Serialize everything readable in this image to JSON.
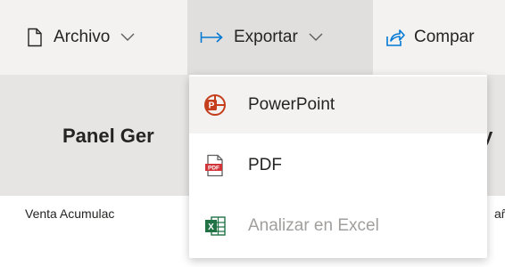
{
  "toolbar": {
    "archivo_label": "Archivo",
    "exportar_label": "Exportar",
    "compartir_label": "Compar"
  },
  "report": {
    "panel_title": "Panel Ger",
    "panel_title_tail": "y",
    "venta_label": "Venta Acumulac",
    "venta_tail": "añ"
  },
  "export_menu": {
    "items": [
      {
        "label": "PowerPoint",
        "icon": "powerpoint-icon",
        "enabled": true,
        "hovered": true
      },
      {
        "label": "PDF",
        "icon": "pdf-icon",
        "enabled": true
      },
      {
        "label": "Analizar en Excel",
        "icon": "excel-icon",
        "enabled": false
      }
    ]
  },
  "colors": {
    "toolbar_bg": "#f3f2f1",
    "exportar_active_bg": "#e1dfdd",
    "accent_blue": "#0078d4",
    "powerpoint_red": "#c43e1c",
    "pdf_red": "#d13438",
    "excel_green": "#217346",
    "disabled_text": "#a19f9d"
  }
}
